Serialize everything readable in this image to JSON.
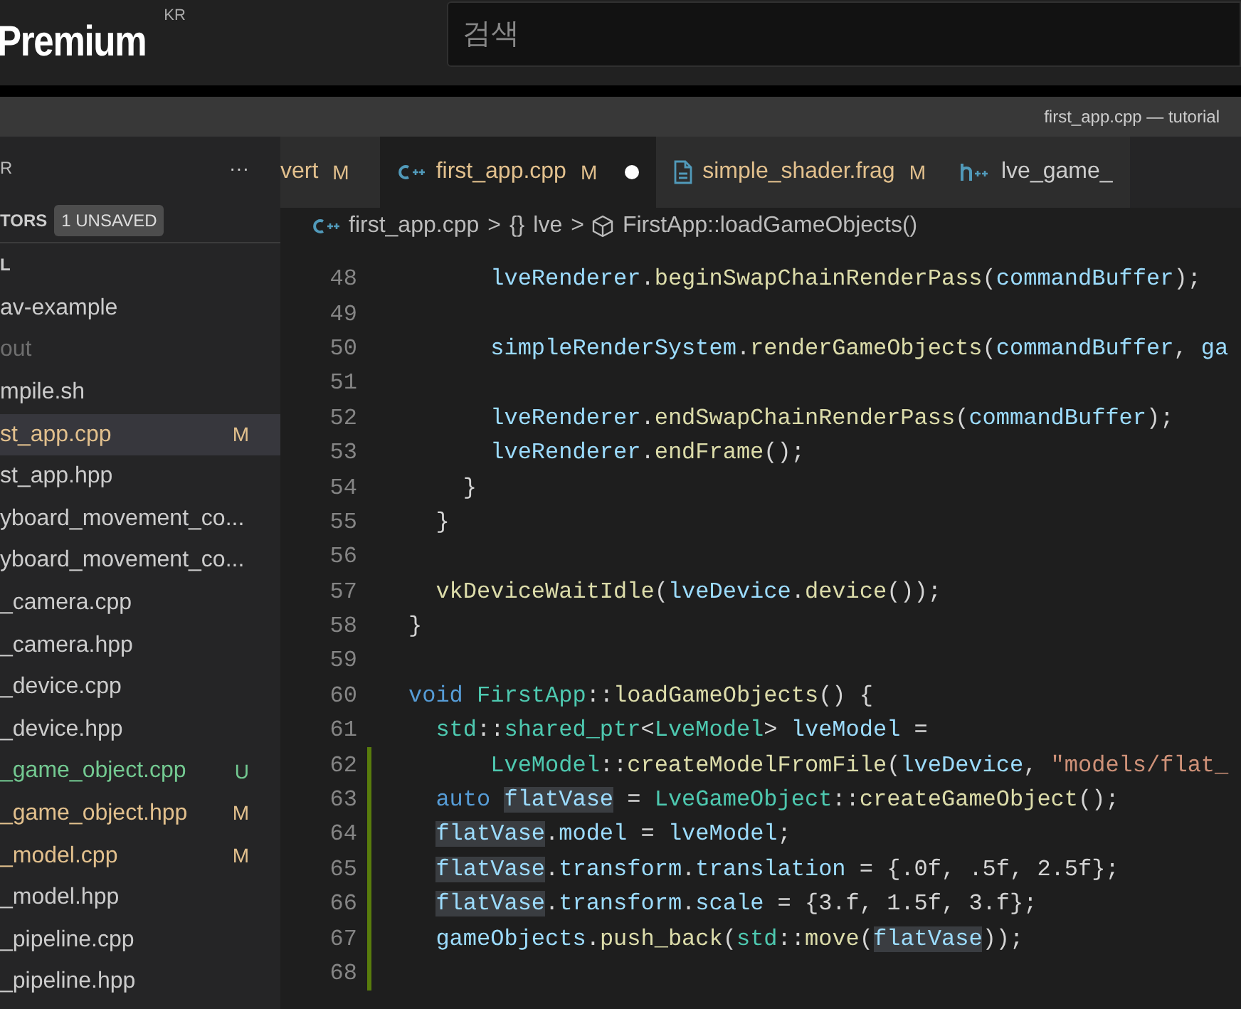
{
  "site_header": {
    "logo": "Premium",
    "region": "KR",
    "search": {
      "placeholder": "검색"
    }
  },
  "window": {
    "title": "first_app.cpp — tutorial"
  },
  "sidebar": {
    "title": "R",
    "more": "···",
    "open_editors": {
      "label": "TORS",
      "badge": "1 UNSAVED"
    },
    "folder": "L",
    "files": [
      {
        "name": "av-example",
        "selected": false,
        "kind": "normal"
      },
      {
        "name": "out",
        "selected": false,
        "kind": "ignored"
      },
      {
        "name": "mpile.sh",
        "selected": false,
        "kind": "normal"
      },
      {
        "name": "st_app.cpp",
        "status": "M",
        "selected": true,
        "kind": "modified"
      },
      {
        "name": "st_app.hpp",
        "selected": false,
        "kind": "normal"
      },
      {
        "name": "yboard_movement_co...",
        "selected": false,
        "kind": "normal"
      },
      {
        "name": "yboard_movement_co...",
        "selected": false,
        "kind": "normal"
      },
      {
        "name": "_camera.cpp",
        "selected": false,
        "kind": "normal"
      },
      {
        "name": "_camera.hpp",
        "selected": false,
        "kind": "normal"
      },
      {
        "name": "_device.cpp",
        "selected": false,
        "kind": "normal"
      },
      {
        "name": "_device.hpp",
        "selected": false,
        "kind": "normal"
      },
      {
        "name": "_game_object.cpp",
        "status": "U",
        "selected": false,
        "kind": "untracked"
      },
      {
        "name": "_game_object.hpp",
        "status": "M",
        "selected": false,
        "kind": "modified"
      },
      {
        "name": "_model.cpp",
        "status": "M",
        "selected": false,
        "kind": "modified"
      },
      {
        "name": "_model.hpp",
        "selected": false,
        "kind": "normal"
      },
      {
        "name": "_pipeline.cpp",
        "selected": false,
        "kind": "normal"
      },
      {
        "name": "_pipeline.hpp",
        "selected": false,
        "kind": "normal"
      }
    ]
  },
  "tabs": [
    {
      "label": "vert",
      "status": "M",
      "selected": false,
      "dirty": false,
      "kind": "none"
    },
    {
      "label": "first_app.cpp",
      "status": "M",
      "selected": true,
      "dirty": true,
      "kind": "cpp"
    },
    {
      "label": "simple_shader.frag",
      "status": "M",
      "selected": false,
      "dirty": false,
      "kind": "file"
    },
    {
      "label": "lve_game_",
      "selected": false,
      "dirty": false,
      "kind": "hpp"
    }
  ],
  "breadcrumb": {
    "file": "first_app.cpp",
    "sep": ">",
    "namespace_icon": "{}",
    "namespace": "lve",
    "symbol": "FirstApp::loadGameObjects()"
  },
  "code": [
    {
      "number": "48",
      "modified": false,
      "tokens": [
        {
          "text": "      lveRenderer",
          "kind": "var"
        },
        {
          "text": ".",
          "kind": "plain"
        },
        {
          "text": "beginSwapChainRenderPass",
          "kind": "fn"
        },
        {
          "text": "(",
          "kind": "plain"
        },
        {
          "text": "commandBuffer",
          "kind": "var"
        },
        {
          "text": ");",
          "kind": "plain"
        }
      ]
    },
    {
      "number": "49",
      "modified": false
    },
    {
      "number": "50",
      "modified": false,
      "tokens": [
        {
          "text": "      simpleRenderSystem",
          "kind": "var"
        },
        {
          "text": ".",
          "kind": "plain"
        },
        {
          "text": "renderGameObjects",
          "kind": "fn"
        },
        {
          "text": "(",
          "kind": "plain"
        },
        {
          "text": "commandBuffer",
          "kind": "var"
        },
        {
          "text": ", ",
          "kind": "plain"
        },
        {
          "text": "ga",
          "kind": "var"
        }
      ]
    },
    {
      "number": "51",
      "modified": false
    },
    {
      "number": "52",
      "modified": false,
      "tokens": [
        {
          "text": "      lveRenderer",
          "kind": "var"
        },
        {
          "text": ".",
          "kind": "plain"
        },
        {
          "text": "endSwapChainRenderPass",
          "kind": "fn"
        },
        {
          "text": "(",
          "kind": "plain"
        },
        {
          "text": "commandBuffer",
          "kind": "var"
        },
        {
          "text": ");",
          "kind": "plain"
        }
      ]
    },
    {
      "number": "53",
      "modified": false,
      "tokens": [
        {
          "text": "      lveRenderer",
          "kind": "var"
        },
        {
          "text": ".",
          "kind": "plain"
        },
        {
          "text": "endFrame",
          "kind": "fn"
        },
        {
          "text": "();",
          "kind": "plain"
        }
      ]
    },
    {
      "number": "54",
      "modified": false,
      "tokens": [
        {
          "text": "    }",
          "kind": "plain"
        }
      ]
    },
    {
      "number": "55",
      "modified": false,
      "tokens": [
        {
          "text": "  }",
          "kind": "plain"
        }
      ]
    },
    {
      "number": "56",
      "modified": false
    },
    {
      "number": "57",
      "modified": false,
      "tokens": [
        {
          "text": "  vkDeviceWaitIdle",
          "kind": "fn"
        },
        {
          "text": "(",
          "kind": "plain"
        },
        {
          "text": "lveDevice",
          "kind": "var"
        },
        {
          "text": ".",
          "kind": "plain"
        },
        {
          "text": "device",
          "kind": "fn"
        },
        {
          "text": "());",
          "kind": "plain"
        }
      ]
    },
    {
      "number": "58",
      "modified": false,
      "tokens": [
        {
          "text": "}",
          "kind": "plain"
        }
      ]
    },
    {
      "number": "59",
      "modified": false
    },
    {
      "number": "60",
      "modified": false,
      "tokens": [
        {
          "text": "void ",
          "kind": "keyword"
        },
        {
          "text": "FirstApp",
          "kind": "type"
        },
        {
          "text": "::",
          "kind": "plain"
        },
        {
          "text": "loadGameObjects",
          "kind": "fn"
        },
        {
          "text": "() {",
          "kind": "plain"
        }
      ]
    },
    {
      "number": "61",
      "modified": false,
      "tokens": [
        {
          "text": "  std",
          "kind": "type"
        },
        {
          "text": "::",
          "kind": "plain"
        },
        {
          "text": "shared_ptr",
          "kind": "type"
        },
        {
          "text": "<",
          "kind": "plain"
        },
        {
          "text": "LveModel",
          "kind": "type"
        },
        {
          "text": "> ",
          "kind": "plain"
        },
        {
          "text": "lveModel",
          "kind": "var"
        },
        {
          "text": " =",
          "kind": "plain"
        }
      ]
    },
    {
      "number": "62",
      "modified": true,
      "tokens": [
        {
          "text": "      LveModel",
          "kind": "type"
        },
        {
          "text": "::",
          "kind": "plain"
        },
        {
          "text": "createModelFromFile",
          "kind": "fn"
        },
        {
          "text": "(",
          "kind": "plain"
        },
        {
          "text": "lveDevice",
          "kind": "var"
        },
        {
          "text": ", ",
          "kind": "plain"
        },
        {
          "text": "\"models/flat_",
          "kind": "string"
        }
      ]
    },
    {
      "number": "63",
      "modified": true,
      "tokens": [
        {
          "text": "  auto ",
          "kind": "keyword"
        },
        {
          "text": "flatVase",
          "kind": "match"
        },
        {
          "text": " = ",
          "kind": "plain"
        },
        {
          "text": "LveGameObject",
          "kind": "type"
        },
        {
          "text": "::",
          "kind": "plain"
        },
        {
          "text": "createGameObject",
          "kind": "fn"
        },
        {
          "text": "();",
          "kind": "plain"
        }
      ]
    },
    {
      "number": "64",
      "modified": true,
      "tokens": [
        {
          "text": "  flatVase",
          "kind": "match"
        },
        {
          "text": ".",
          "kind": "plain"
        },
        {
          "text": "model",
          "kind": "var"
        },
        {
          "text": " = ",
          "kind": "plain"
        },
        {
          "text": "lveModel",
          "kind": "var"
        },
        {
          "text": ";",
          "kind": "plain"
        }
      ]
    },
    {
      "number": "65",
      "modified": true,
      "tokens": [
        {
          "text": "  flatVase",
          "kind": "match"
        },
        {
          "text": ".",
          "kind": "plain"
        },
        {
          "text": "transform",
          "kind": "var"
        },
        {
          "text": ".",
          "kind": "plain"
        },
        {
          "text": "translation",
          "kind": "var"
        },
        {
          "text": " = {.0f, .5f, 2.5f};",
          "kind": "plain"
        }
      ]
    },
    {
      "number": "66",
      "modified": true,
      "tokens": [
        {
          "text": "  flatVase",
          "kind": "match"
        },
        {
          "text": ".",
          "kind": "plain"
        },
        {
          "text": "transform",
          "kind": "var"
        },
        {
          "text": ".",
          "kind": "plain"
        },
        {
          "text": "scale",
          "kind": "var"
        },
        {
          "text": " = {3.f, 1.5f, 3.f};",
          "kind": "plain"
        }
      ]
    },
    {
      "number": "67",
      "modified": true,
      "tokens": [
        {
          "text": "  gameObjects",
          "kind": "var"
        },
        {
          "text": ".",
          "kind": "plain"
        },
        {
          "text": "push_back",
          "kind": "fn"
        },
        {
          "text": "(",
          "kind": "plain"
        },
        {
          "text": "std",
          "kind": "type"
        },
        {
          "text": "::",
          "kind": "plain"
        },
        {
          "text": "move",
          "kind": "fn"
        },
        {
          "text": "(",
          "kind": "plain"
        },
        {
          "text": "flatVase",
          "kind": "match"
        },
        {
          "text": "));",
          "kind": "plain"
        }
      ]
    },
    {
      "number": "68",
      "modified": true
    }
  ]
}
